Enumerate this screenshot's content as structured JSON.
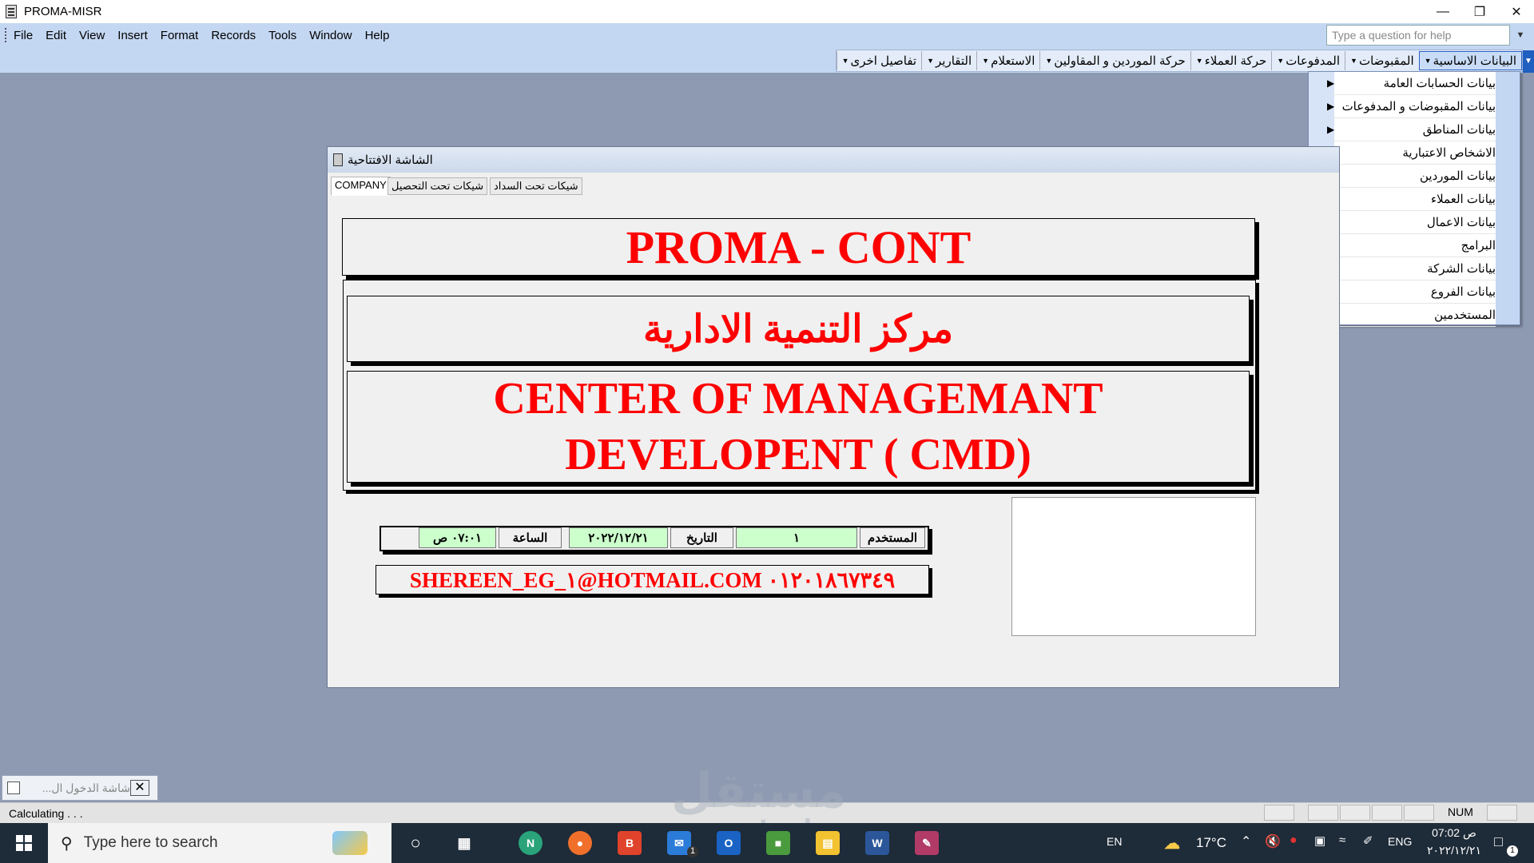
{
  "window": {
    "title": "PROMA-MISR"
  },
  "menubar": {
    "items": [
      "File",
      "Edit",
      "View",
      "Insert",
      "Format",
      "Records",
      "Tools",
      "Window",
      "Help"
    ],
    "help_placeholder": "Type a question for help"
  },
  "toolbar": {
    "items": [
      "البيانات الاساسية",
      "المقبوضات",
      "المدفوعات",
      "حركة العملاء",
      "حركة الموردين و المقاولين",
      "الاستعلام",
      "التقارير",
      "تفاصيل اخرى"
    ]
  },
  "dropdown": {
    "items": [
      {
        "label": "بيانات الحسابات العامة",
        "submenu": true
      },
      {
        "label": "بيانات المقبوضات و المدفوعات",
        "submenu": true
      },
      {
        "label": "بيانات المناطق",
        "submenu": true
      },
      {
        "label": "الاشخاص الاعتبارية",
        "submenu": true
      },
      {
        "label": "بيانات الموردين",
        "submenu": true
      },
      {
        "label": "بيانات العملاء",
        "submenu": true
      },
      {
        "label": "بيانات الاعمال",
        "submenu": true
      },
      {
        "label": "البرامج",
        "submenu": true
      },
      {
        "label": "بيانات الشركة",
        "submenu": false
      },
      {
        "label": "بيانات الفروع",
        "submenu": false
      },
      {
        "label": "المستخدمين",
        "submenu": false
      }
    ]
  },
  "form": {
    "title": "الشاشة الافتتاحية",
    "tabs": [
      "COMPANY",
      "شيكات تحت التحصيل",
      "شيكات تحت السداد"
    ],
    "banner_line1": "PROMA - CONT",
    "banner_arabic": "مركز التنمية الادارية",
    "banner_english_1": "CENTER OF MANAGEMANT",
    "banner_english_2": "DEVELOPENT ( CMD)",
    "user_label": "المستخدم",
    "user_value": "١",
    "date_label": "التاريخ",
    "date_value": "٢٠٢٢/١٢/٢١",
    "time_label": "الساعة",
    "time_value": "٠٧:٠١ ص",
    "contact": "SHEREEN_EG_١@HOTMAIL.COM ٠١٢٠١٨٦٧٣٤٩"
  },
  "minimized_form": {
    "title": "شاشة الدخول ال..."
  },
  "status": {
    "text": "Calculating . . .",
    "num": "NUM"
  },
  "taskbar": {
    "search_placeholder": "Type here to search",
    "lang": "EN",
    "weather": "17°C",
    "keyboard": "ENG",
    "time": "07:02 ص",
    "date": "٢٠٢٢/١٢/٢١",
    "notif_count": "1",
    "outlook_badge": "1"
  },
  "watermark": {
    "arabic": "مستقل",
    "latin": "mostaql.com"
  },
  "colors": {
    "banner_text": "#FF0000",
    "field_bg": "#CCFFCC",
    "workspace": "#8E99B2",
    "menubar": "#C4D7F2"
  }
}
